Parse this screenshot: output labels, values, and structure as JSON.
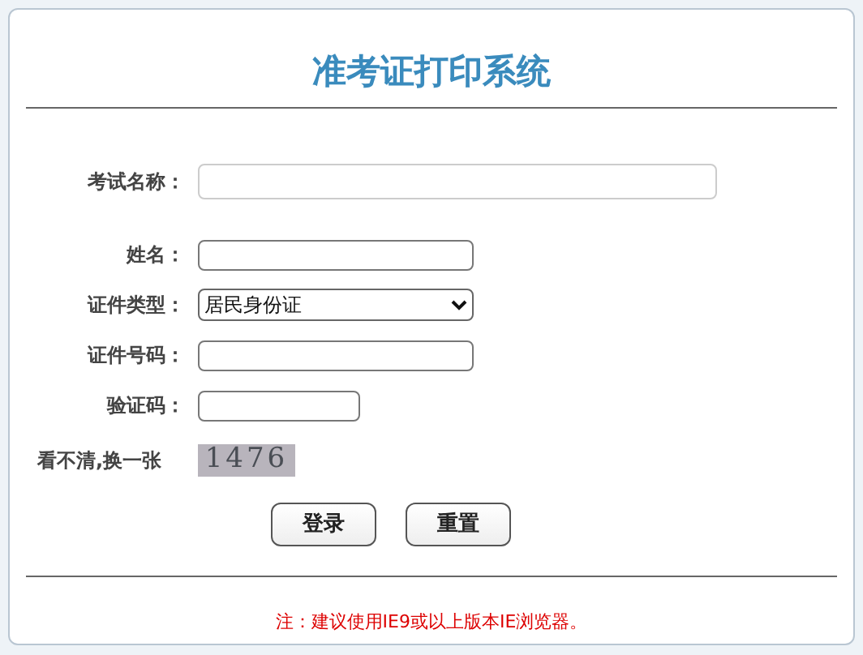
{
  "title": "准考证打印系统",
  "fields": [
    {
      "kind": "text",
      "label": "考试名称："
    },
    {
      "kind": "text",
      "label": "姓名："
    },
    {
      "kind": "select",
      "label": "证件类型：",
      "value": "居民身份证"
    },
    {
      "kind": "text",
      "label": "证件号码："
    },
    {
      "kind": "text",
      "label": "验证码："
    }
  ],
  "captcha": {
    "refresh_link": "看不清,换一张",
    "code": "1476"
  },
  "buttons": [
    "登录",
    "重置"
  ],
  "note": "注：建议使用IE9或以上版本IE浏览器。"
}
